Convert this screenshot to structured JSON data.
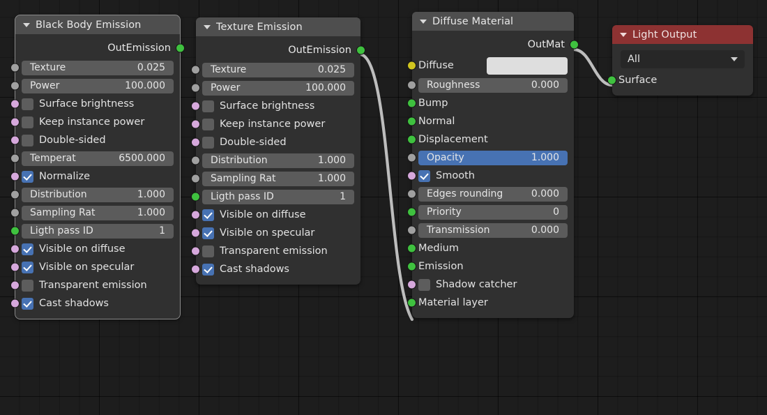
{
  "editor": {
    "background": "#1d1d1d",
    "grid_color": "#131313"
  },
  "colors": {
    "socket_gray": "#a0a0a0",
    "socket_pink": "#d6a8dc",
    "socket_green": "#3fc13f",
    "socket_yellow": "#d1c51f",
    "header_gray": "#4e4e4e",
    "header_red": "#8d3232",
    "field_gray": "#5b5b5b",
    "field_highlight": "#4772b3",
    "checkbox_on": "#4772b3",
    "link": "#b9b9b9"
  },
  "nodes": [
    {
      "id": "black-body-emission",
      "title": "Black Body Emission",
      "header_style": "gray",
      "selected": true,
      "outputs": [
        {
          "label": "OutEmission",
          "socket": "green"
        }
      ],
      "rows": [
        {
          "type": "field",
          "socket": "gray",
          "name": "Texture",
          "value": "0.025"
        },
        {
          "type": "field",
          "socket": "gray",
          "name": "Power",
          "value": "100.000"
        },
        {
          "type": "checkbox",
          "socket": "pink",
          "name": "Surface brightness",
          "checked": false
        },
        {
          "type": "checkbox",
          "socket": "pink",
          "name": "Keep instance power",
          "checked": false
        },
        {
          "type": "checkbox",
          "socket": "pink",
          "name": "Double-sided",
          "checked": false
        },
        {
          "type": "field",
          "socket": "gray",
          "name": "Temperat",
          "value": "6500.000"
        },
        {
          "type": "checkbox",
          "socket": "pink",
          "name": "Normalize",
          "checked": true
        },
        {
          "type": "field",
          "socket": "gray",
          "name": "Distribution",
          "value": "1.000"
        },
        {
          "type": "field",
          "socket": "gray",
          "name": "Sampling Rat",
          "value": "1.000"
        },
        {
          "type": "field",
          "socket": "green",
          "name": "Ligth pass ID",
          "value": "1"
        },
        {
          "type": "checkbox",
          "socket": "pink",
          "name": "Visible on diffuse",
          "checked": true
        },
        {
          "type": "checkbox",
          "socket": "pink",
          "name": "Visible on specular",
          "checked": true
        },
        {
          "type": "checkbox",
          "socket": "pink",
          "name": "Transparent emission",
          "checked": false
        },
        {
          "type": "checkbox",
          "socket": "pink",
          "name": "Cast shadows",
          "checked": true
        }
      ]
    },
    {
      "id": "texture-emission",
      "title": "Texture Emission",
      "header_style": "gray",
      "selected": false,
      "outputs": [
        {
          "label": "OutEmission",
          "socket": "green"
        }
      ],
      "rows": [
        {
          "type": "field",
          "socket": "gray",
          "name": "Texture",
          "value": "0.025"
        },
        {
          "type": "field",
          "socket": "gray",
          "name": "Power",
          "value": "100.000"
        },
        {
          "type": "checkbox",
          "socket": "pink",
          "name": "Surface brightness",
          "checked": false
        },
        {
          "type": "checkbox",
          "socket": "pink",
          "name": "Keep instance power",
          "checked": false
        },
        {
          "type": "checkbox",
          "socket": "pink",
          "name": "Double-sided",
          "checked": false
        },
        {
          "type": "field",
          "socket": "gray",
          "name": "Distribution",
          "value": "1.000"
        },
        {
          "type": "field",
          "socket": "gray",
          "name": "Sampling Rat",
          "value": "1.000"
        },
        {
          "type": "field",
          "socket": "green",
          "name": "Ligth pass ID",
          "value": "1"
        },
        {
          "type": "checkbox",
          "socket": "pink",
          "name": "Visible on diffuse",
          "checked": true
        },
        {
          "type": "checkbox",
          "socket": "pink",
          "name": "Visible on specular",
          "checked": true
        },
        {
          "type": "checkbox",
          "socket": "pink",
          "name": "Transparent emission",
          "checked": false
        },
        {
          "type": "checkbox",
          "socket": "pink",
          "name": "Cast shadows",
          "checked": true
        }
      ]
    },
    {
      "id": "diffuse-material",
      "title": "Diffuse Material",
      "header_style": "gray",
      "selected": false,
      "outputs": [
        {
          "label": "OutMat",
          "socket": "green"
        }
      ],
      "rows": [
        {
          "type": "swatch",
          "socket": "yellow",
          "name": "Diffuse",
          "value": "#dedede"
        },
        {
          "type": "field",
          "socket": "gray",
          "name": "Roughness",
          "value": "0.000"
        },
        {
          "type": "plain",
          "socket": "green",
          "name": "Bump"
        },
        {
          "type": "plain",
          "socket": "green",
          "name": "Normal"
        },
        {
          "type": "plain",
          "socket": "green",
          "name": "Displacement"
        },
        {
          "type": "field",
          "socket": "gray",
          "name": "Opacity",
          "value": "1.000",
          "highlight": true
        },
        {
          "type": "checkbox",
          "socket": "pink",
          "name": "Smooth",
          "checked": true
        },
        {
          "type": "field",
          "socket": "gray",
          "name": "Edges rounding",
          "value": "0.000"
        },
        {
          "type": "field",
          "socket": "green",
          "name": "Priority",
          "value": "0"
        },
        {
          "type": "field",
          "socket": "gray",
          "name": "Transmission",
          "value": "0.000"
        },
        {
          "type": "plain",
          "socket": "green",
          "name": "Medium"
        },
        {
          "type": "plain",
          "socket": "green",
          "name": "Emission"
        },
        {
          "type": "checkbox",
          "socket": "pink",
          "name": "Shadow catcher",
          "checked": false
        },
        {
          "type": "plain",
          "socket": "green",
          "name": "Material layer"
        }
      ]
    },
    {
      "id": "light-output",
      "title": "Light Output",
      "header_style": "red",
      "selected": false,
      "outputs": [],
      "rows": [
        {
          "type": "dropdown",
          "socket": null,
          "name": "All"
        },
        {
          "type": "plain",
          "socket": "green",
          "name": "Surface"
        }
      ]
    }
  ],
  "links": [
    {
      "from": "texture-emission.OutEmission",
      "to": "diffuse-material.Emission"
    },
    {
      "from": "diffuse-material.OutMat",
      "to": "light-output.Surface"
    }
  ]
}
